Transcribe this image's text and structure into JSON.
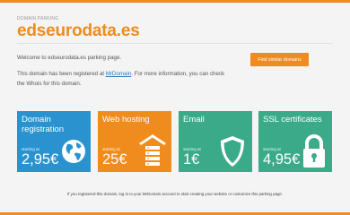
{
  "header": {
    "eyebrow": "DOMAIN PARKING",
    "domain": "edseurodata.es"
  },
  "intro": {
    "welcome": "Welcome to edseurodata.es parking page.",
    "info_before_link": "This domain has been registered at ",
    "info_link": "MrDomain",
    "info_after_link": ". For more information, you can check the Whois for this domain."
  },
  "cta": {
    "label": "Find similar domains"
  },
  "tiles": [
    {
      "title": "Domain registration",
      "starting": "starting at",
      "price": "2,95€",
      "color": "#2a93cf",
      "icon": "globe-icon"
    },
    {
      "title": "Web hosting",
      "starting": "starting at",
      "price": "25€",
      "color": "#f08c1e",
      "icon": "hosting-server-icon"
    },
    {
      "title": "Email",
      "starting": "starting at",
      "price": "1€",
      "color": "#3aaa88",
      "icon": "shield-icon"
    },
    {
      "title": "SSL certificates",
      "starting": "starting at",
      "price": "4,95€",
      "color": "#3aaa88",
      "icon": "padlock-icon"
    }
  ],
  "footer": {
    "text": "If you registered this domain, log in to your MrDomain account to start creating your website or customize this parking page."
  },
  "colors": {
    "accent": "#f08c1e",
    "blue": "#2a93cf",
    "green": "#3aaa88"
  }
}
